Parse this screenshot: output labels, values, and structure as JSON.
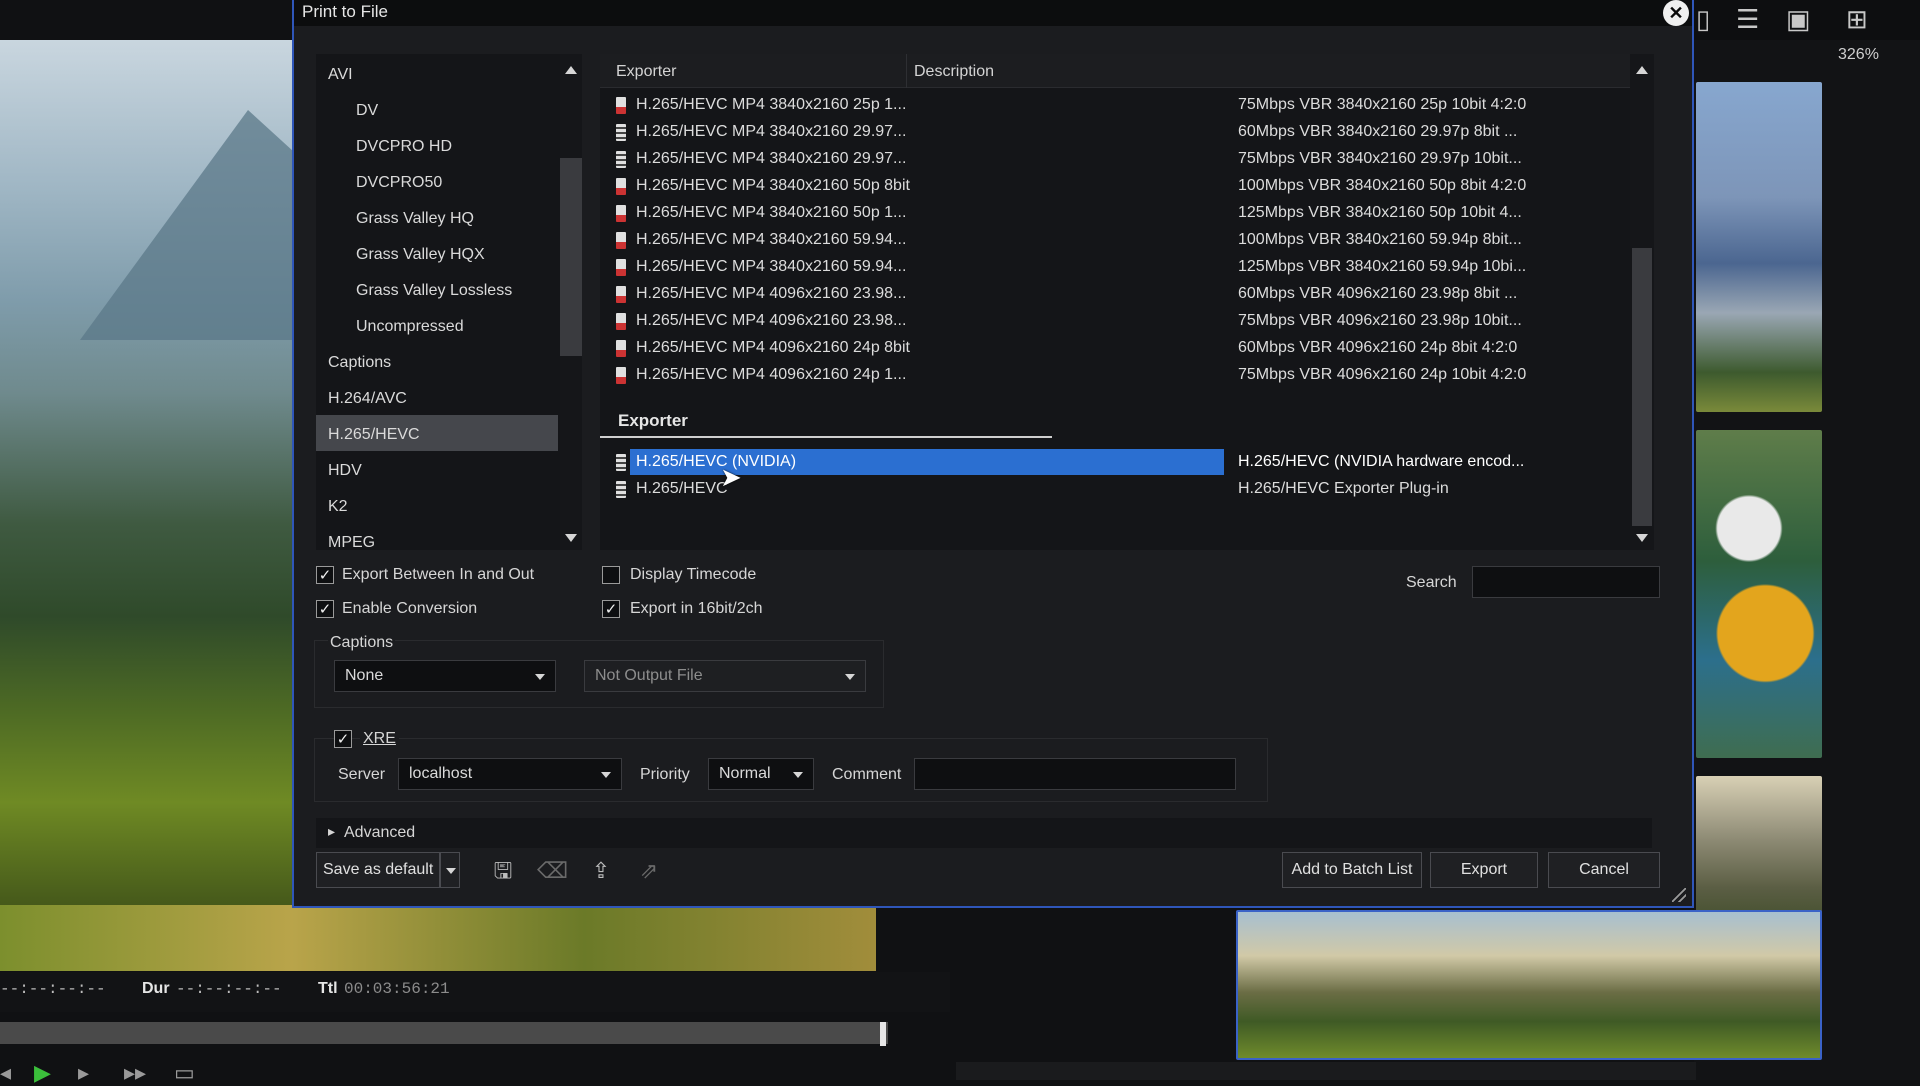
{
  "dialog": {
    "title": "Print to File",
    "close_glyph": "✕"
  },
  "categories": {
    "items": [
      {
        "label": "AVI",
        "level": "top"
      },
      {
        "label": "DV",
        "level": "sub"
      },
      {
        "label": "DVCPRO HD",
        "level": "sub"
      },
      {
        "label": "DVCPRO50",
        "level": "sub"
      },
      {
        "label": "Grass Valley HQ",
        "level": "sub"
      },
      {
        "label": "Grass Valley HQX",
        "level": "sub"
      },
      {
        "label": "Grass Valley Lossless",
        "level": "sub"
      },
      {
        "label": "Uncompressed",
        "level": "sub"
      },
      {
        "label": "Captions",
        "level": "top"
      },
      {
        "label": "H.264/AVC",
        "level": "top"
      },
      {
        "label": "H.265/HEVC",
        "level": "top",
        "selected": true
      },
      {
        "label": "HDV",
        "level": "top"
      },
      {
        "label": "K2",
        "level": "top"
      },
      {
        "label": "MPEG",
        "level": "top"
      }
    ]
  },
  "exporters": {
    "col_exporter": "Exporter",
    "col_description": "Description",
    "presets": [
      {
        "name": "H.265/HEVC MP4 3840x2160 25p 1...",
        "desc": "75Mbps VBR 3840x2160 25p 10bit 4:2:0",
        "icon": "seq"
      },
      {
        "name": "H.265/HEVC MP4 3840x2160 29.97...",
        "desc": "60Mbps VBR 3840x2160 29.97p 8bit ...",
        "icon": "film"
      },
      {
        "name": "H.265/HEVC MP4 3840x2160 29.97...",
        "desc": "75Mbps VBR 3840x2160 29.97p 10bit...",
        "icon": "film"
      },
      {
        "name": "H.265/HEVC MP4 3840x2160 50p 8bit",
        "desc": "100Mbps VBR 3840x2160 50p 8bit 4:2:0",
        "icon": "seq"
      },
      {
        "name": "H.265/HEVC MP4 3840x2160 50p 1...",
        "desc": "125Mbps VBR 3840x2160 50p 10bit 4...",
        "icon": "seq"
      },
      {
        "name": "H.265/HEVC MP4 3840x2160 59.94...",
        "desc": "100Mbps VBR 3840x2160 59.94p 8bit...",
        "icon": "seq"
      },
      {
        "name": "H.265/HEVC MP4 3840x2160 59.94...",
        "desc": "125Mbps VBR 3840x2160 59.94p 10bi...",
        "icon": "seq"
      },
      {
        "name": "H.265/HEVC MP4 4096x2160 23.98...",
        "desc": "60Mbps VBR 4096x2160 23.98p 8bit ...",
        "icon": "seq"
      },
      {
        "name": "H.265/HEVC MP4 4096x2160 23.98...",
        "desc": "75Mbps VBR 4096x2160 23.98p 10bit...",
        "icon": "seq"
      },
      {
        "name": "H.265/HEVC MP4 4096x2160 24p 8bit",
        "desc": "60Mbps VBR 4096x2160 24p 8bit 4:2:0",
        "icon": "seq"
      },
      {
        "name": "H.265/HEVC MP4 4096x2160 24p 1...",
        "desc": "75Mbps VBR 4096x2160 24p 10bit 4:2:0",
        "icon": "seq"
      }
    ],
    "group_title": "Exporter",
    "group_items": [
      {
        "name": "H.265/HEVC (NVIDIA)",
        "desc": "H.265/HEVC (NVIDIA hardware encod...",
        "icon": "film",
        "selected": true
      },
      {
        "name": "H.265/HEVC",
        "desc": "H.265/HEVC Exporter Plug-in",
        "icon": "film"
      }
    ]
  },
  "options": {
    "export_between": {
      "label": "Export Between In and Out",
      "checked": true
    },
    "enable_conversion": {
      "label": "Enable Conversion",
      "checked": true
    },
    "display_timecode": {
      "label": "Display Timecode",
      "checked": false
    },
    "export_16bit": {
      "label": "Export in 16bit/2ch",
      "checked": true
    },
    "search_label": "Search",
    "search_value": "",
    "check_glyph": "✓"
  },
  "captions": {
    "label": "Captions",
    "type_value": "None",
    "output_value": "Not Output File"
  },
  "xre": {
    "label": "XRE",
    "checked": true,
    "server_label": "Server",
    "server_value": "localhost",
    "priority_label": "Priority",
    "priority_value": "Normal",
    "comment_label": "Comment",
    "comment_value": ""
  },
  "advanced": {
    "label": "Advanced",
    "glyph": "▸"
  },
  "footer": {
    "save_default": "Save as default",
    "add_batch": "Add to Batch List",
    "export": "Export",
    "cancel": "Cancel",
    "icons": [
      "save-icon",
      "delete-icon",
      "import-icon",
      "export-preset-icon"
    ]
  },
  "background": {
    "zoom": "326%",
    "in_out": "--:--:--:--",
    "dur_label": "Dur",
    "dur_value": "--:--:--:--",
    "ttl_label": "Ttl",
    "ttl_value": "00:03:56:21"
  }
}
